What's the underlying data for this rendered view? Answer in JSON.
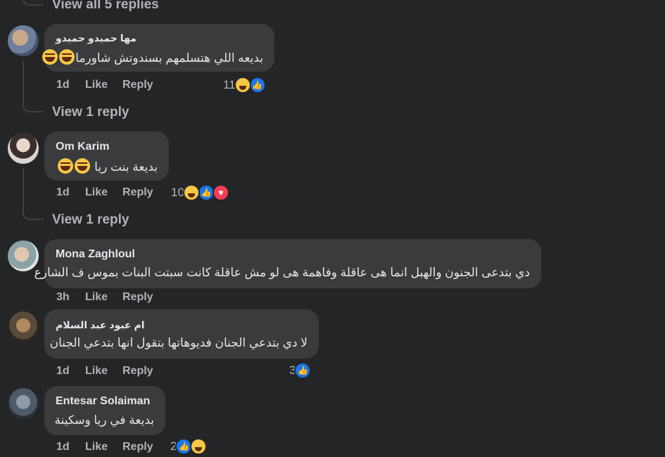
{
  "top": {
    "view_replies": "View all 5 replies"
  },
  "comments": [
    {
      "author": "مها حميدو حميدو",
      "text": "بديعه اللي هتسلمهم بسندوتش شاورما",
      "time": "1d",
      "like": "Like",
      "reply": "Reply",
      "reaction_count": "11",
      "reactions": [
        "haha-icon",
        "like-icon"
      ],
      "view_replies": "View 1 reply"
    },
    {
      "author": "Om Karim",
      "text": "بديعة بنت ريا",
      "time": "1d",
      "like": "Like",
      "reply": "Reply",
      "reaction_count": "10",
      "reactions": [
        "haha-icon",
        "like-icon",
        "love-icon"
      ],
      "view_replies": "View 1 reply"
    },
    {
      "author": "Mona Zaghloul",
      "text": "دي بتدعى الجنون والهبل انما هى عاقلة وفاهمة هى لو مش عاقلة كانت سبتت البنات بموس ف الشارع",
      "time": "3h",
      "like": "Like",
      "reply": "Reply"
    },
    {
      "author": "ام عبود عبد السلام",
      "text": "لا دي بتدعي الجنان فديوهاتها بتقول انها بتدعي الجنان",
      "time": "1d",
      "like": "Like",
      "reply": "Reply",
      "reaction_count": "3",
      "reactions": [
        "like-icon"
      ]
    },
    {
      "author": "Entesar Solaiman",
      "text": "بديعة في ريا وسكينة",
      "time": "1d",
      "like": "Like",
      "reply": "Reply",
      "reaction_count": "2",
      "reactions": [
        "like-icon",
        "haha-icon"
      ]
    }
  ],
  "colors": {
    "background": "#242526",
    "bubble": "#3a3b3c",
    "secondary_text": "#b0b3b8",
    "like_blue": "#1877f2",
    "love_red": "#f33e58"
  }
}
